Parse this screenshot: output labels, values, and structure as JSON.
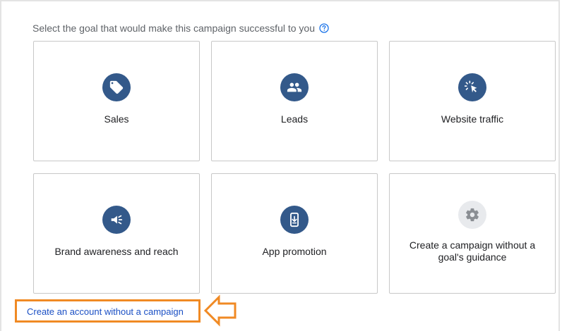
{
  "heading": {
    "text": "Select the goal that would make this campaign successful to you"
  },
  "goals": [
    {
      "label": "Sales",
      "icon": "tag-icon"
    },
    {
      "label": "Leads",
      "icon": "people-icon"
    },
    {
      "label": "Website traffic",
      "icon": "cursor-click-icon"
    },
    {
      "label": "Brand awareness and reach",
      "icon": "megaphone-icon"
    },
    {
      "label": "App promotion",
      "icon": "phone-download-icon"
    },
    {
      "label": "Create a campaign without a goal's guidance",
      "icon": "gear-icon"
    }
  ],
  "footer": {
    "create_account_link": "Create an account without a campaign"
  },
  "colors": {
    "icon_blue": "#33598a",
    "highlight_orange": "#f08a24",
    "link_blue": "#1a4fc4"
  }
}
